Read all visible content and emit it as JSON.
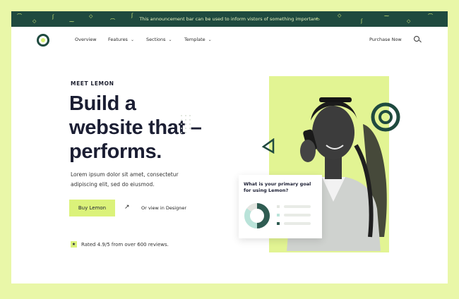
{
  "announcement": {
    "text": "This announcement bar can be used to inform vistors of something important."
  },
  "nav": {
    "items": [
      {
        "label": "Overview",
        "has_dropdown": false
      },
      {
        "label": "Features",
        "has_dropdown": true
      },
      {
        "label": "Sections",
        "has_dropdown": true
      },
      {
        "label": "Template",
        "has_dropdown": true
      }
    ],
    "purchase_label": "Purchase Now",
    "search_icon": "search-icon",
    "dropdown_icon": "chevron-down-icon"
  },
  "hero": {
    "eyebrow": "MEET LEMON",
    "headline_lines": [
      "Build a",
      "website that –",
      "performs."
    ],
    "subtext": "Lorem ipsum dolor sit amet, consectetur adipiscing elit, sed do eiusmod.",
    "primary_button": "Buy Lemon",
    "arrow_icon": "↗",
    "secondary_link": "Or view in Designer",
    "rating_icon": "star-icon",
    "rating_text": "Rated 4.9/5 from over 600 reviews."
  },
  "survey_card": {
    "question": "What is your primary goal for using Lemon?",
    "chart_segments": [
      {
        "color": "#2f5c52",
        "fraction": 0.5
      },
      {
        "color": "#b9e3d9",
        "fraction": 0.35
      },
      {
        "color": "#e3e6e1",
        "fraction": 0.15
      }
    ],
    "legend_colors": [
      "#e3e6e1",
      "#b9e3d9",
      "#2f5c52"
    ]
  },
  "colors": {
    "page_bg": "#e9f7a8",
    "accent": "#dbf27a",
    "dark_green": "#1f4a3f",
    "heading": "#1b1e33"
  }
}
